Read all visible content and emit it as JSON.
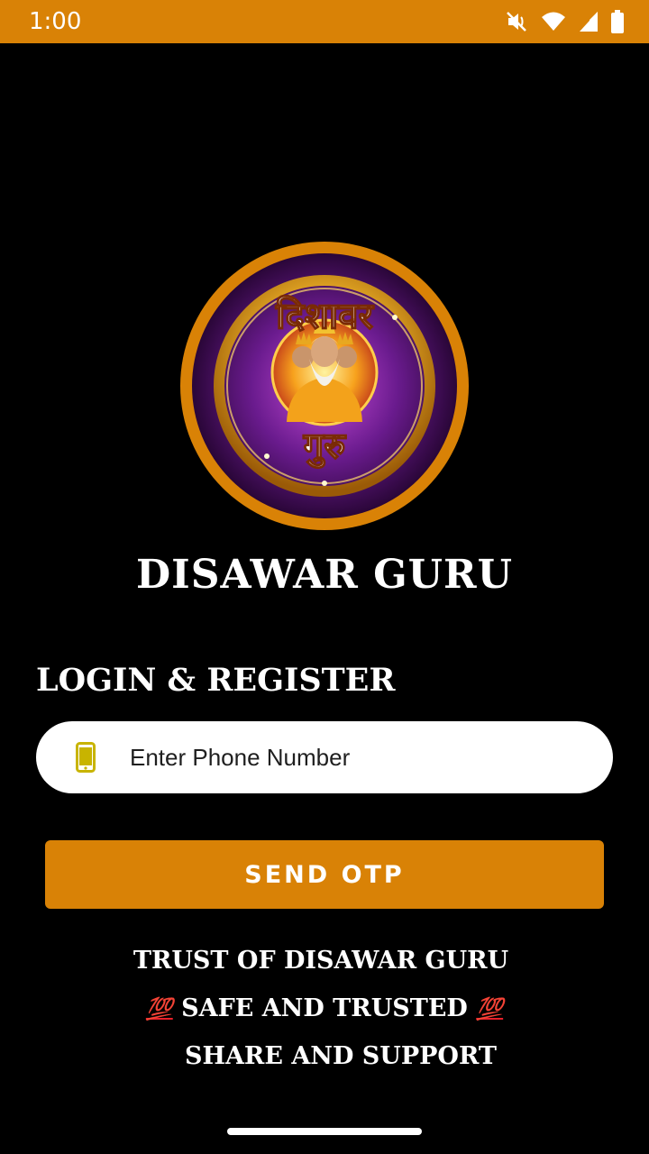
{
  "status_bar": {
    "time": "1:00",
    "icons": [
      "mute-icon",
      "wifi-icon",
      "signal-icon",
      "battery-icon"
    ]
  },
  "logo": {
    "top_text": "दिशावर",
    "bottom_text": "गुरु"
  },
  "app_title": "DISAWAR GURU",
  "login": {
    "section_title": "LOGIN & REGISTER",
    "phone_placeholder": "Enter Phone Number",
    "phone_value": "",
    "send_button": "SEND OTP"
  },
  "footer": {
    "line1": "TRUST OF DISAWAR GURU",
    "line2_emoji": "💯",
    "line2_text": "SAFE AND TRUSTED",
    "line3": "SHARE AND SUPPORT"
  },
  "colors": {
    "accent": "#d98206",
    "background": "#000000",
    "field": "#ffffff",
    "phone_icon": "#c8b400"
  }
}
